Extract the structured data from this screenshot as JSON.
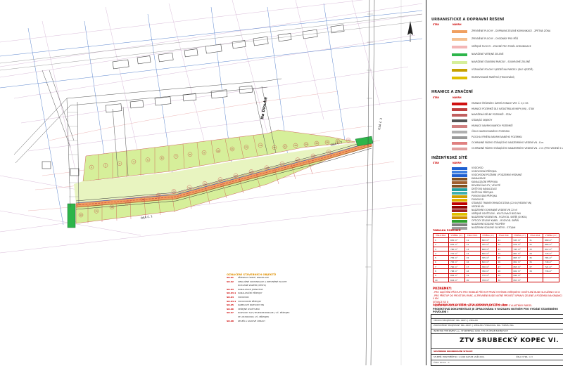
{
  "legend": {
    "section_urban": "URBANISTICKÉ A DOPRAVNÍ ŘEŠENÍ",
    "col_stav": "STAV",
    "col_navrh": "NÁVRH",
    "urban_items": [
      {
        "text": "ZPEVNĚNÉ PLOCHY - DOPRAVNÍ ZELENÉ KOMUNIKACE - ZPĚTNÁ ZÓNA",
        "color": "#f0a060"
      },
      {
        "text": "ZPEVNĚNÉ PLOCHY - CHODNÍKY PRO PĚŠÍ",
        "color": "#f5c090"
      },
      {
        "text": "VEŘEJNÉ PLOCHY - ZELENÉ PRO PODÉL KOMUNIKACE",
        "color": "#f3b6b6"
      },
      {
        "text": "NAVRŽENÉ VEŘEJNÉ ZELENĚ",
        "color": "#2db54a"
      },
      {
        "text": "NAVRŽENÉ STAVEBNÍ PARCELY - SOUKROMÉ ZELENĚ",
        "color": "#d6ef9a"
      },
      {
        "text": "VÝZNAČNÉ POLOHY VJEZDŮ NA PARCELY (DLE VJEZDŮ)",
        "color": "#c6a000"
      },
      {
        "text": "REZERVOVANÉ PAMĚTNÍ (TRUDOVÁNÍ)",
        "color": "#e0c000"
      }
    ],
    "section_borders": "HRANICE A ZNAČENÍ",
    "border_items": [
      {
        "text": "HRANICE ŘEŠENÍHO ÚZEMÍ ZONACE VRT. Č. 0,2 KS",
        "color": "#d01010"
      },
      {
        "text": "HRANICE POZEMKŮ DLE KATASTRÁLNÍ MAPY (KN) - STAV",
        "color": "#c04040"
      },
      {
        "text": "NAVRŽENÁ DĚLBY POZEMKŮ - STAV",
        "color": "#c06060"
      },
      {
        "text": "STÁVAJÍCÍ OBJEKTY",
        "color": "#555555"
      },
      {
        "text": "HRANICE NAVRHOVANÝCH POZEMKŮ",
        "color": "#d08080"
      },
      {
        "text": "ČÍSLO NAVRHOVANÉHO POZEMKU",
        "color": "#b0b0b0"
      },
      {
        "text": "PLOCHA VÝMĚRA NAVRHOVANÉHO POZEMKU",
        "color": "#999999"
      },
      {
        "text": "OCHRANNÉ PÁSMO STÁVAJÍCÍHO NADZEMNÍHO VEDENÍ VN - 8 m",
        "color": "#e08080"
      },
      {
        "text": "OCHRANNÉ PÁSMO STÁVAJÍCÍHO NADZEMNÍHO VEDENÍ VN - 2 m (PRO VEDENÍ S IZOLACÍ VODIČŮ)",
        "color": "#e0a0a0"
      }
    ],
    "section_networks": "INŽENÝRSKÉ SÍTĚ",
    "network_items": [
      {
        "text": "VODOVOD",
        "color": "#2060d0"
      },
      {
        "text": "VODOVODNÍ PŘÍPOJKA",
        "color": "#4080e0"
      },
      {
        "text": "VODOVODNÍ POŽÁRNÍ / PODZEMNÍ HYDRANT",
        "color": "#2060d0"
      },
      {
        "text": "KANALIZACE",
        "color": "#805020"
      },
      {
        "text": "KANALIZAČNÍ PŘÍPOJKA",
        "color": "#a06030"
      },
      {
        "text": "REVIZNÍ ŠACHTY, VPUSTĚ",
        "color": "#805020"
      },
      {
        "text": "DEŠŤOVÁ KANALIZACE",
        "color": "#20a0a0"
      },
      {
        "text": "DEŠŤOVÁ PŘÍPOJKA",
        "color": "#40b0b0"
      },
      {
        "text": "PLYNOVODNÍ PŘÍPOJKA",
        "color": "#d0a000"
      },
      {
        "text": "PLYNOVOD",
        "color": "#e0b000"
      },
      {
        "text": "STÁVAJÍCÍ TRANSFORMAČNÍ ZÓNA (22 KV/VEDENÍ VN)",
        "color": "#c00000"
      },
      {
        "text": "VEDENÍ VN",
        "color": "#900000"
      },
      {
        "text": "NADZEMNÍ OCHRANNÉ VEDENÍ VN 22 kV",
        "color": "#a02020"
      },
      {
        "text": "VEŘEJNÉ OSVĚTLENÍ - KOUTLOVACÍ BOD NN",
        "color": "#e0c000"
      },
      {
        "text": "NADZEMNÍ VEDENÍ NN - ROZVOD. SKŘÍŇ (SOKOL)",
        "color": "#d09000"
      },
      {
        "text": "OPTICKÝ ZELENÝ KABEL - ROZVOD. SKŘÍŇ",
        "color": "#30a030"
      },
      {
        "text": "NADZEMNÍ SDÍLENÉ PODPĚRY",
        "color": "#808080"
      },
      {
        "text": "NADZEMNÍ SDÍLENÉ ELEKTRO - STOJAN",
        "color": "#a0a0a0"
      }
    ]
  },
  "parcel_table": {
    "title": "TABULKA POZEMKŮ",
    "col_cislo": "ČÍSLO POZ.",
    "col_vymera": "VÝMĚRA (m²)",
    "rows": [
      [
        "1",
        "850 m²",
        "11",
        "820 m²",
        "21",
        "935 m²",
        "31",
        "889 m²"
      ],
      [
        "2",
        "855 m²",
        "12",
        "795 m²",
        "22",
        "876 m²",
        "32",
        "866 m²"
      ],
      [
        "3",
        "780 m²",
        "13",
        "808 m²",
        "23",
        "795 m²",
        "33",
        "912 m²"
      ],
      [
        "4",
        "770 m²",
        "14",
        "800 m²",
        "24",
        "801 m²",
        "34",
        "776 m²"
      ],
      [
        "5",
        "755 m²",
        "15",
        "795 m²",
        "25",
        "805 m²",
        "35",
        "765 m²"
      ],
      [
        "6",
        "765 m²",
        "16",
        "810 m²",
        "26",
        "802 m²",
        "36",
        "748 m²"
      ],
      [
        "7",
        "790 m²",
        "17",
        "790 m²",
        "27",
        "855 m²",
        "37",
        "721 m²"
      ],
      [
        "8",
        "788 m²",
        "18",
        "786 m²",
        "28",
        "822 m²",
        "38",
        "736 m²"
      ],
      [
        "9",
        "802 m²",
        "19",
        "770 m²",
        "29",
        "840 m²",
        "",
        " "
      ],
      [
        "10",
        "816 m²",
        "20",
        "758 m²",
        "30",
        "853 m²",
        "",
        " "
      ]
    ]
  },
  "notes": {
    "title": "POZNÁMKY:",
    "lines": [
      "- PRO ZAJIŠTĚNÍ PŘÍSTUPU PRO MOBILNÍ PŘÍSTUP PRVNÍ VYHÝBEK VEŘEJNÉHO OSVĚTLENÍ BUDE SLOUŽENO SO 8",
      "- PRO PŘÍSTUP DO PROSTORU PARC. A ZPEVNĚNÍ BUDE NUTNÉ PROVÉST ÚPRAVU ZELENĚ A POZEMKU NA KRAJNICI 0 KM",
      "  SITUACE SO 8",
      "- VJEZDY NA POZEMKY PŘÍPUSTNÉ V RÁMCI PŘÍPOJEK DLE DOHODY S VLASTNÍKY PARCEL"
    ],
    "system_line": "SOUŘADNICOVÝ SYSTÉM - JTSK          VÝŠKOVÝ SYSTÉM - Bpv",
    "final_line": "PROJEKTOVÁ DOKUMENTACE JE ZPRACOVÁNA V ROZSAHU NUTNÉM PRO VYDÁNÍ STAVEBNÍHO POVOLENÍ I"
  },
  "codes_legend": {
    "title": "OZNAČENÍ STAVEBNÍCH OBJEKTŮ",
    "items": [
      {
        "code": "SO.01",
        "text": "PŘÍPRAVA ÚZEMÍ, PARCELACE"
      },
      {
        "code": "SO.02",
        "text": "OBSLUŽNÉ KOMUNIKACE A ZPEVNĚNÉ PLOCHY"
      },
      {
        "code": "",
        "text": "DOČASNÉ ZÁZEMÍ (MÍSTO)"
      },
      {
        "code": "SO.03",
        "text": "KANALIZACE JEDNOTNÁ"
      },
      {
        "code": "SO.03.1",
        "text": "KANALIZAČNÍ PŘÍPOJKY"
      },
      {
        "code": "SO.04",
        "text": "VODOVOD"
      },
      {
        "code": "SO.04.1",
        "text": "VODOVODNÍ PŘÍPOJKY"
      },
      {
        "code": "SO.05",
        "text": "KABELOVÉ ROZVODY NN"
      },
      {
        "code": "SO.06",
        "text": "VEŘEJNÉ OSVĚTLENÍ"
      },
      {
        "code": "SO.07",
        "text": "ROZVODY SLP (TELEKOMUNIKACE), VČ. PŘÍPOJEK"
      },
      {
        "code": "",
        "text": "STL PLYNOVOD, VČ. PŘÍPOJEK"
      },
      {
        "code": "SO.08",
        "text": "ZELEŇ A SADOVÉ ÚPRAVY"
      }
    ]
  },
  "stamp": {
    "row1": "VEDOUCÍ PROJEKTANT    ING. ARCH. J. ZIEGLER",
    "row2": "ZODPOVĚDNÝ PROJEKTANT    ING. ARCH. J. ZIEGLER    VYPRACOVAL    ING. TOMÁŠ, ING.",
    "row3": "INVESTOR   THE INVEST a.s., STUDENTSKÁ 1906, 370 05 ČESKÉ BUDĚJOVICE",
    "title": "ZTV SRUBECKÝ KOPEC VI.",
    "drawing": "SOUHRNNÁ KOORDINAČNÍ SITUACE",
    "meta": "STUPEŇ: PDSP    MĚŘÍTKO: 1:1000    DATUM: ZÁŘÍ 2011",
    "number": "ČÍSLO VÝKR.: C.3",
    "part": "ČÁST: SO 0.1 - 1"
  },
  "map_labels": {
    "street": "Na Dlouhé",
    "road_a": "OSA č. 1",
    "road_b": "OSA č. 2",
    "road_c": "OSA č. 3",
    "plot_numbers": [
      "1",
      "2",
      "3",
      "4",
      "5",
      "6",
      "7",
      "8",
      "9",
      "10",
      "11",
      "12",
      "13",
      "14",
      "15",
      "16",
      "17",
      "18",
      "19",
      "20",
      "21",
      "22",
      "23",
      "24",
      "25",
      "26",
      "27",
      "28",
      "29",
      "30",
      "31",
      "32",
      "33",
      "34",
      "35",
      "36",
      "37",
      "38"
    ]
  }
}
